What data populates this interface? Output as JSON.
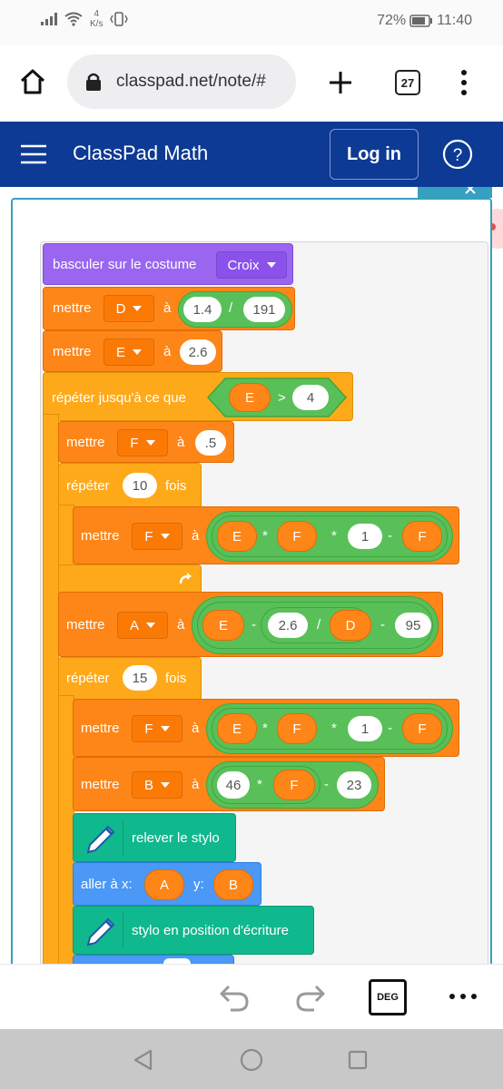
{
  "status_bar": {
    "network_speed_value": "4",
    "network_speed_unit": "K/s",
    "battery": "72%",
    "time": "11:40",
    "icons": [
      "signal-icon",
      "wifi-icon",
      "vibrate-icon",
      "battery-icon"
    ]
  },
  "browser": {
    "url": "classpad.net/note/#",
    "tab_count": "27",
    "icons": [
      "home-icon",
      "lock-icon",
      "plus-icon",
      "more-vert-icon"
    ]
  },
  "app_header": {
    "title": "ClassPad Math",
    "login_label": "Log in",
    "icons": [
      "hamburger-menu-icon",
      "help-icon"
    ]
  },
  "blocks": {
    "costume": {
      "label": "basculer sur le costume",
      "value": "Croix"
    },
    "set_d": {
      "label": "mettre",
      "var": "D",
      "to": "à",
      "num": "1.4",
      "div": "/",
      "den": "191"
    },
    "set_e": {
      "label": "mettre",
      "var": "E",
      "to": "à",
      "value": "2.6"
    },
    "repeat_until": {
      "label": "répéter jusqu'à ce que",
      "left": "E",
      "op": ">",
      "right": "4"
    },
    "set_f_init": {
      "label": "mettre",
      "var": "F",
      "to": "à",
      "value": ".5"
    },
    "repeat_10": {
      "label": "répéter",
      "count": "10",
      "times": "fois"
    },
    "set_f_1": {
      "label": "mettre",
      "var": "F",
      "to": "à",
      "a": "E",
      "mul1": "*",
      "b": "F",
      "mul2": "*",
      "one": "1",
      "minus": "-",
      "c": "F"
    },
    "set_a": {
      "label": "mettre",
      "var": "A",
      "to": "à",
      "a": "E",
      "minus1": "-",
      "b": "2.6",
      "div": "/",
      "c": "D",
      "minus2": "-",
      "d": "95"
    },
    "repeat_15": {
      "label": "répéter",
      "count": "15",
      "times": "fois"
    },
    "set_f_2": {
      "label": "mettre",
      "var": "F",
      "to": "à",
      "a": "E",
      "mul1": "*",
      "b": "F",
      "mul2": "*",
      "one": "1",
      "minus": "-",
      "c": "F"
    },
    "set_b": {
      "label": "mettre",
      "var": "B",
      "to": "à",
      "a": "46",
      "mul": "*",
      "b": "F",
      "minus": "-",
      "c": "23"
    },
    "pen_up": {
      "label": "relever le stylo"
    },
    "goto": {
      "label": "aller à x:",
      "x": "A",
      "ylabel": "y:",
      "y": "B"
    },
    "pen_down": {
      "label": "stylo en position d'écriture"
    }
  },
  "toolbar": {
    "deg_label": "DEG",
    "icons": [
      "undo-icon",
      "redo-icon",
      "more-horiz-icon"
    ]
  },
  "colors": {
    "header": "#0d3a94",
    "looks_purple": "#9a66f0",
    "variables_orange": "#fe8517",
    "control_yellow": "#fea919",
    "operators_green": "#59c059",
    "pen_teal": "#10b88d",
    "motion_blue": "#4b98f6"
  }
}
